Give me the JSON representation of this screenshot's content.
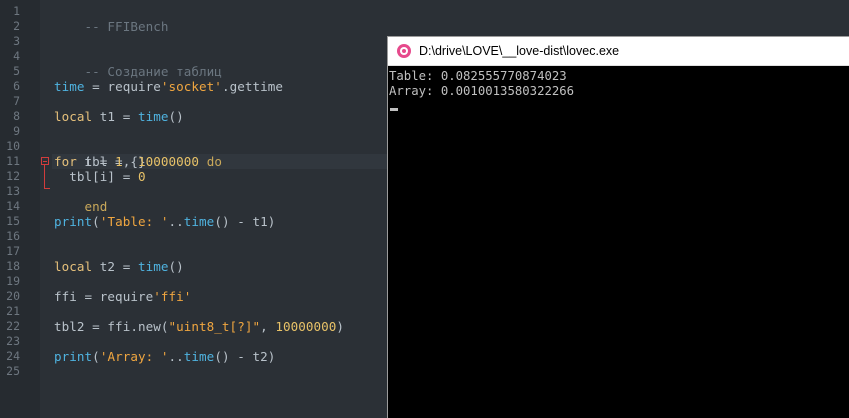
{
  "editor": {
    "line_numbers": [
      "1",
      "2",
      "3",
      "4",
      "5",
      "6",
      "7",
      "8",
      "9",
      "10",
      "11",
      "12",
      "13",
      "14",
      "15",
      "16",
      "17",
      "18",
      "19",
      "20",
      "21",
      "22",
      "23",
      "24",
      "25"
    ],
    "lines": {
      "l1": [
        "-- FFIBench"
      ],
      "l4": [
        "-- Создание таблиц"
      ],
      "l6": [
        "time",
        " = ",
        "require",
        "'socket'",
        ".",
        "gettime"
      ],
      "l8": [
        "local",
        " t1 = ",
        "time",
        "()"
      ],
      "l10": [
        "tbl = {}"
      ],
      "l11": [
        "for",
        " i = ",
        "1",
        ", ",
        "10000000",
        " ",
        "do"
      ],
      "l12": [
        "  tbl[i] = ",
        "0"
      ],
      "l13": [
        "end"
      ],
      "l15": [
        "print",
        "(",
        "'Table: '",
        "..",
        "time",
        "() - t1)"
      ],
      "l18": [
        "local",
        " t2 = ",
        "time",
        "()"
      ],
      "l20": [
        "ffi = ",
        "require",
        "'ffi'"
      ],
      "l22": [
        "tbl2 = ffi.",
        "new",
        "(",
        "\"uint8_t[?]\"",
        ", ",
        "10000000",
        ")"
      ],
      "l24": [
        "print",
        "(",
        "'Array: '",
        "..",
        "time",
        "() - t2)"
      ]
    }
  },
  "console": {
    "title": "D:\\drive\\LOVE\\__love-dist\\lovec.exe",
    "output": [
      "Table: 0.082555770874023",
      "Array: 0.0010013580322266"
    ]
  },
  "colors": {
    "editor_bg": "#2b3036",
    "keyword": "#e5c07b",
    "function": "#4fb3e0",
    "string": "#f0a640",
    "comment": "#6b7680",
    "console_bg": "#000000"
  }
}
